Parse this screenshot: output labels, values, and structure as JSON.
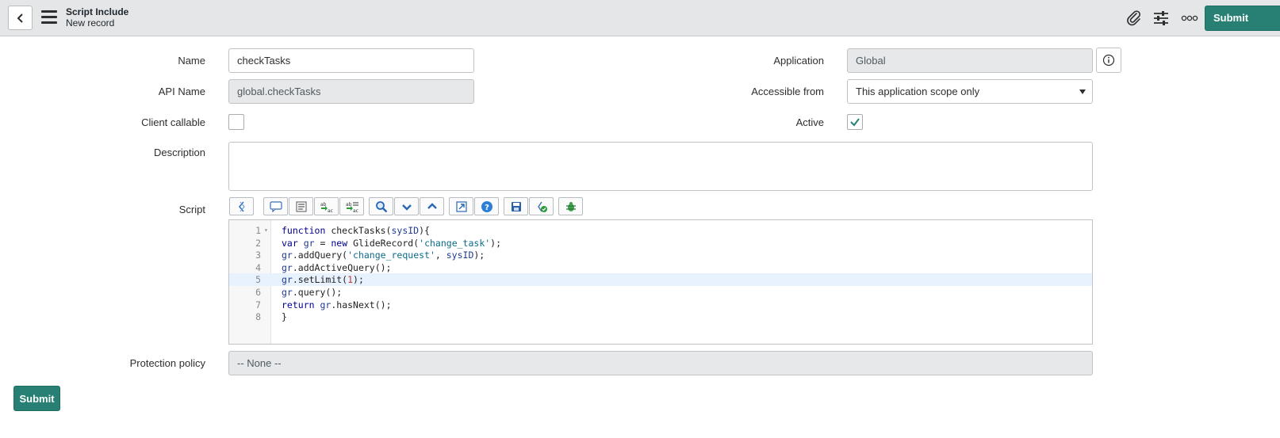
{
  "header": {
    "title": "Script Include",
    "subtitle": "New record",
    "submit_label": "Submit"
  },
  "form": {
    "name": {
      "label": "Name",
      "value": "checkTasks"
    },
    "api_name": {
      "label": "API Name",
      "value": "global.checkTasks"
    },
    "client_callable": {
      "label": "Client callable",
      "checked": false
    },
    "description": {
      "label": "Description",
      "value": ""
    },
    "application": {
      "label": "Application",
      "value": "Global"
    },
    "accessible_from": {
      "label": "Accessible from",
      "value": "This application scope only"
    },
    "active": {
      "label": "Active",
      "checked": true
    },
    "script": {
      "label": "Script",
      "lines": [
        "function checkTasks(sysID){",
        "var gr = new GlideRecord('change_task');",
        "gr.addQuery('change_request', sysID);",
        "gr.addActiveQuery();",
        "gr.setLimit(1);",
        "gr.query();",
        "return gr.hasNext();",
        "}"
      ],
      "line_numbers": [
        "1",
        "2",
        "3",
        "4",
        "5",
        "6",
        "7",
        "8"
      ],
      "active_line": 5
    },
    "protection_policy": {
      "label": "Protection policy",
      "value": "-- None --"
    }
  },
  "toolbar_icons": [
    "format-code-icon",
    "comment-icon",
    "format-text-icon",
    "replace-icon",
    "replace-all-icon",
    "search-icon",
    "chevron-down-icon",
    "chevron-up-icon",
    "fullscreen-icon",
    "help-icon",
    "save-icon",
    "script-debug-icon",
    "debugger-icon"
  ],
  "footer": {
    "submit_label": "Submit"
  },
  "colors": {
    "accent": "#278073",
    "header_bg": "#e4e6e7"
  }
}
